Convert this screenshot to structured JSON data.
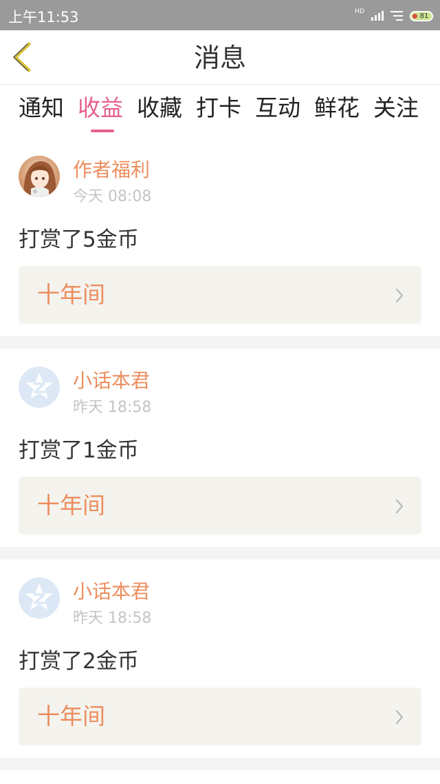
{
  "status_bar": {
    "time": "上午11:53",
    "network_label": "HD",
    "battery_level": "81"
  },
  "header": {
    "title": "消息",
    "back_icon": "chevron-left-icon"
  },
  "tabs": [
    {
      "label": "通知",
      "active": false
    },
    {
      "label": "收益",
      "active": true
    },
    {
      "label": "收藏",
      "active": false
    },
    {
      "label": "打卡",
      "active": false
    },
    {
      "label": "互动",
      "active": false
    },
    {
      "label": "鲜花",
      "active": false
    },
    {
      "label": "关注",
      "active": false
    }
  ],
  "messages": [
    {
      "sender": "作者福利",
      "time": "今天 08:08",
      "text": "打赏了5金币",
      "book": "十年间",
      "avatar": "anime-girl-avatar"
    },
    {
      "sender": "小话本君",
      "time": "昨天 18:58",
      "text": "打赏了1金币",
      "book": "十年间",
      "avatar": "z-star-avatar"
    },
    {
      "sender": "小话本君",
      "time": "昨天 18:58",
      "text": "打赏了2金币",
      "book": "十年间",
      "avatar": "z-star-avatar"
    }
  ],
  "colors": {
    "accent_pink": "#e55f8e",
    "sender_orange": "#ec8d5e",
    "back_arrow": "#d9c13a",
    "status_bar": "#9a9a9a",
    "book_box": "#f4f3ee"
  }
}
